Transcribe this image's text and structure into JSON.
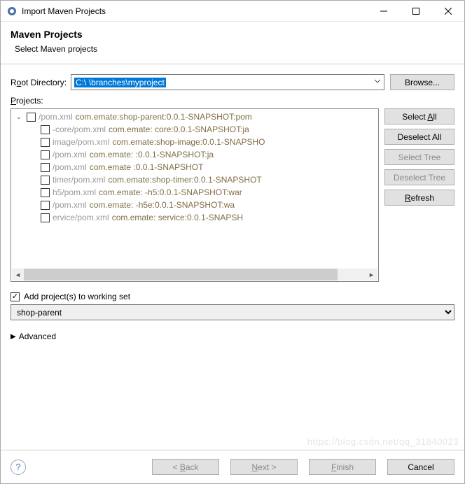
{
  "window": {
    "title": "Import Maven Projects"
  },
  "banner": {
    "heading": "Maven Projects",
    "sub": "Select Maven projects"
  },
  "root": {
    "label_pre": "R",
    "label_accel": "o",
    "label_post": "ot Directory:",
    "value_prefix": "C:\\",
    "value_blur": "           ",
    "value_suffix": "\\branches\\myproject",
    "browse": "Browse..."
  },
  "projects": {
    "label_accel": "P",
    "label_post": "rojects:",
    "rows": [
      {
        "indent": 0,
        "twisty": "⌄",
        "pom": "/pom.xml",
        "coord": "com.emate:shop-parent:0.0.1-SNAPSHOT:pom"
      },
      {
        "indent": 1,
        "twisty": "",
        "pom": "-core/pom.xml",
        "coord": "com.emate:      core:0.0.1-SNAPSHOT:ja"
      },
      {
        "indent": 1,
        "twisty": "",
        "pom": "image/pom.xml",
        "coord": "com.emate:shop-image:0.0.1-SNAPSHO"
      },
      {
        "indent": 1,
        "twisty": "",
        "pom": "/pom.xml",
        "coord": "com.emate:      :0.0.1-SNAPSHOT:ja"
      },
      {
        "indent": 1,
        "twisty": "",
        "pom": "/pom.xml",
        "coord": "com.emate      :0.0.1-SNAPSHOT"
      },
      {
        "indent": 1,
        "twisty": "",
        "pom": "timer/pom.xml",
        "coord": "com.emate:shop-timer:0.0.1-SNAPSHOT"
      },
      {
        "indent": 1,
        "twisty": "",
        "pom": "h5/pom.xml",
        "coord": "com.emate:    -h5:0.0.1-SNAPSHOT:war"
      },
      {
        "indent": 1,
        "twisty": "",
        "pom": "/pom.xml",
        "coord": "com.emate:    -h5e:0.0.1-SNAPSHOT:wa"
      },
      {
        "indent": 1,
        "twisty": "",
        "pom": "ervice/pom.xml",
        "coord": "com.emate:    service:0.0.1-SNAPSH"
      }
    ],
    "side": {
      "select_all": "Select All",
      "deselect_all": "Deselect All",
      "select_tree": "Select Tree",
      "deselect_tree": "Deselect Tree",
      "refresh": "Refresh"
    }
  },
  "working_set": {
    "label": "Add project(s) to working set",
    "value": "shop-parent"
  },
  "advanced": {
    "label": "Advanced"
  },
  "footer": {
    "back": "< Back",
    "next": "Next >",
    "finish": "Finish",
    "cancel": "Cancel"
  },
  "watermark": "https://blog.csdn.net/qq_31840023"
}
